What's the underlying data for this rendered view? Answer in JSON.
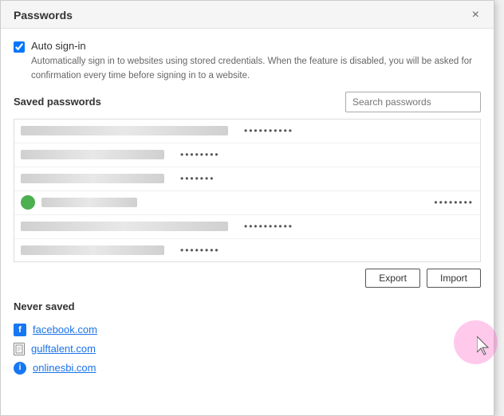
{
  "dialog": {
    "title": "Passwords",
    "close_label": "×"
  },
  "auto_signin": {
    "label": "Auto sign-in",
    "checked": true,
    "description": "Automatically sign in to websites using stored credentials. When the feature is disabled, you will be asked for confirmation every time before signing in to a website."
  },
  "saved_passwords": {
    "title": "Saved passwords",
    "search_placeholder": "Search passwords",
    "rows": [
      {
        "dots": "••••••••••",
        "width": "long"
      },
      {
        "dots": "••••••••",
        "width": "medium"
      },
      {
        "dots": "•••••••",
        "width": "medium"
      },
      {
        "dots": "••••••••",
        "width": "short"
      },
      {
        "dots": "••••••••••",
        "width": "long"
      },
      {
        "dots": "••••••••",
        "width": "medium"
      }
    ]
  },
  "buttons": {
    "export_label": "Export",
    "import_label": "Import"
  },
  "never_saved": {
    "title": "Never saved",
    "items": [
      {
        "icon_type": "fb",
        "label": "facebook.com",
        "icon_letter": "f"
      },
      {
        "icon_type": "doc",
        "label": "gulftalent.com"
      },
      {
        "icon_type": "info",
        "label": "onlinesbi.com",
        "icon_letter": "i"
      }
    ]
  }
}
